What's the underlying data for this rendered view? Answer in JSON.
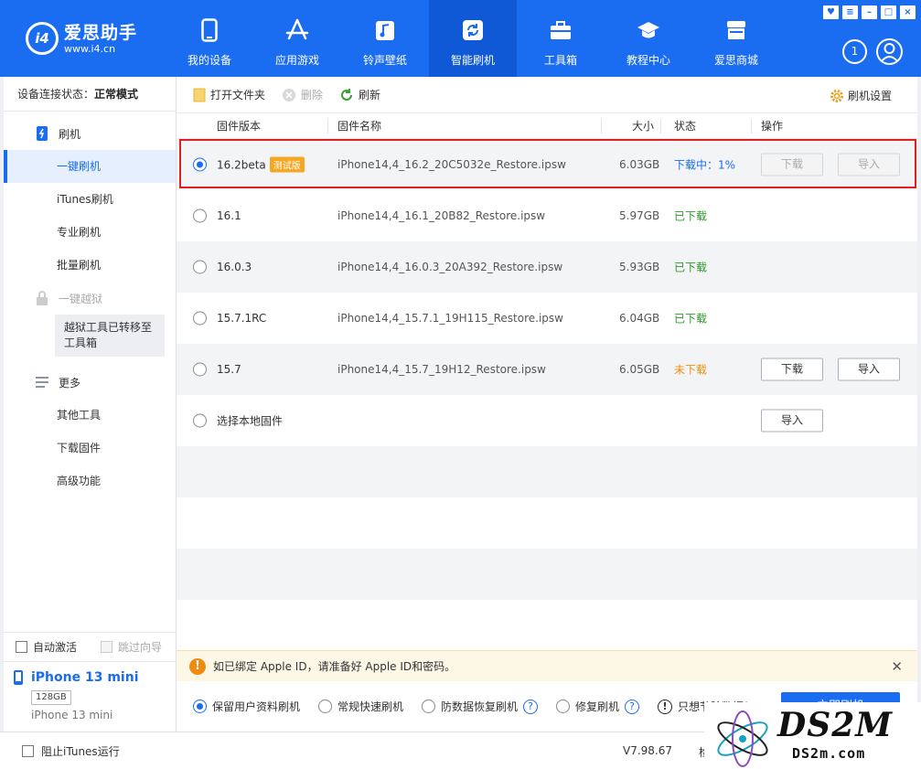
{
  "app": {
    "logo_name": "爱思助手",
    "logo_url": "www.i4.cn",
    "logo_mark": "i4"
  },
  "nav": {
    "items": [
      {
        "label": "我的设备",
        "icon": "phone-icon"
      },
      {
        "label": "应用游戏",
        "icon": "app-store-icon"
      },
      {
        "label": "铃声壁纸",
        "icon": "music-icon"
      },
      {
        "label": "智能刷机",
        "icon": "refresh-icon",
        "active": true
      },
      {
        "label": "工具箱",
        "icon": "toolbox-icon"
      },
      {
        "label": "教程中心",
        "icon": "graduation-cap-icon"
      },
      {
        "label": "爱思商城",
        "icon": "store-icon"
      }
    ],
    "badge": "1"
  },
  "sidebar": {
    "status_label": "设备连接状态：",
    "status_value": "正常模式",
    "group_flash": "刷机",
    "items_flash": [
      "一键刷机",
      "iTunes刷机",
      "专业刷机",
      "批量刷机"
    ],
    "group_jailbreak": "一键越狱",
    "jailbreak_note": "越狱工具已转移至工具箱",
    "group_more": "更多",
    "items_more": [
      "其他工具",
      "下载固件",
      "高级功能"
    ],
    "auto_activate": "自动激活",
    "skip_guide": "跳过向导",
    "device_name": "iPhone 13 mini",
    "device_capacity": "128GB",
    "device_model": "iPhone 13 mini"
  },
  "toolbar": {
    "open_folder": "打开文件夹",
    "delete": "删除",
    "refresh": "刷新",
    "settings": "刷机设置"
  },
  "table": {
    "headers": {
      "version": "固件版本",
      "name": "固件名称",
      "size": "大小",
      "status": "状态",
      "ops": "操作"
    },
    "rows": [
      {
        "version": "16.2beta",
        "tag": "测试版",
        "name": "iPhone14,4_16.2_20C5032e_Restore.ipsw",
        "size": "6.03GB",
        "status": "下载中：1%",
        "download": "下载",
        "import": "导入"
      },
      {
        "version": "16.1",
        "name": "iPhone14,4_16.1_20B82_Restore.ipsw",
        "size": "5.97GB",
        "status": "已下载"
      },
      {
        "version": "16.0.3",
        "name": "iPhone14,4_16.0.3_20A392_Restore.ipsw",
        "size": "5.93GB",
        "status": "已下载"
      },
      {
        "version": "15.7.1RC",
        "name": "iPhone14,4_15.7.1_19H115_Restore.ipsw",
        "size": "6.04GB",
        "status": "已下载"
      },
      {
        "version": "15.7",
        "name": "iPhone14,4_15.7_19H12_Restore.ipsw",
        "size": "6.05GB",
        "status": "未下载",
        "download": "下载",
        "import": "导入"
      },
      {
        "version": "选择本地固件",
        "import": "导入"
      }
    ]
  },
  "notice": {
    "text": "如已绑定 Apple ID，请准备好 Apple ID和密码。"
  },
  "options": {
    "keep_data": "保留用户资料刷机",
    "quick": "常规快速刷机",
    "anti_recovery": "防数据恢复刷机",
    "repair": "修复刷机",
    "partial": "只想节除数据？",
    "flash_now": "立即刷机"
  },
  "statusbar": {
    "block_itunes": "阻止iTunes运行",
    "version": "V7.98.67",
    "update": "检"
  },
  "watermark": {
    "text": "DS2M",
    "sub": "DS2m.com"
  },
  "colors": {
    "primary": "#1a6cf0",
    "highlight": "#e02020",
    "beta_tag": "#f5a623",
    "downloaded": "#2a9a2a",
    "not_downloaded": "#f0900a"
  }
}
